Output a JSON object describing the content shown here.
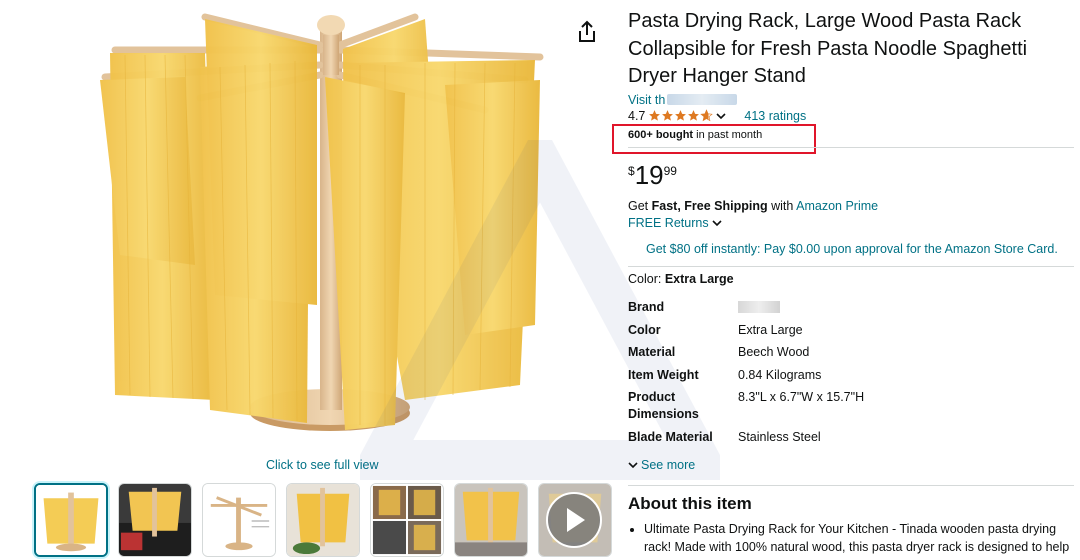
{
  "product": {
    "title": "Pasta Drying Rack, Large Wood Pasta Rack Collapsible for Fresh Pasta Noodle Spaghetti Dryer Hanger Stand",
    "store_link": "Visit th",
    "rating_value": "4.7",
    "rating_fraction": 0.94,
    "ratings_count": "413 ratings",
    "bought_bold": "600+ bought",
    "bought_rest": " in past month"
  },
  "price": {
    "symbol": "$",
    "whole": "19",
    "fraction": "99"
  },
  "shipping": {
    "prefix": "Get ",
    "bold": "Fast, Free Shipping",
    "middle": " with ",
    "prime": "Amazon Prime",
    "returns": "FREE Returns",
    "promo": "Get $80 off instantly: Pay $0.00 upon approval for the Amazon Store Card."
  },
  "variant": {
    "label": "Color: ",
    "value": "Extra Large"
  },
  "specs": [
    {
      "key": "Brand",
      "value": ""
    },
    {
      "key": "Color",
      "value": "Extra Large"
    },
    {
      "key": "Material",
      "value": "Beech Wood"
    },
    {
      "key": "Item Weight",
      "value": "0.84 Kilograms"
    },
    {
      "key": "Product Dimensions",
      "value": "8.3\"L x 6.7\"W x 15.7\"H"
    },
    {
      "key": "Blade Material",
      "value": "Stainless Steel"
    }
  ],
  "see_more": "See more",
  "about": {
    "heading": "About this item",
    "bullet_1": "Ultimate Pasta Drying Rack for Your Kitchen - Tinada wooden pasta drying rack! Made with 100% natural wood, this pasta dryer rack is designed to help"
  },
  "gallery": {
    "full_view": "Click to see full view",
    "thumbnails": [
      "pasta-rack-main",
      "rack-in-car",
      "rack-diagram",
      "rack-with-pasta",
      "rack-collage",
      "rack-kitchen",
      "rack-video"
    ]
  },
  "colors": {
    "link": "#007185",
    "star": "#de7921",
    "highlight": "#e0152a"
  }
}
